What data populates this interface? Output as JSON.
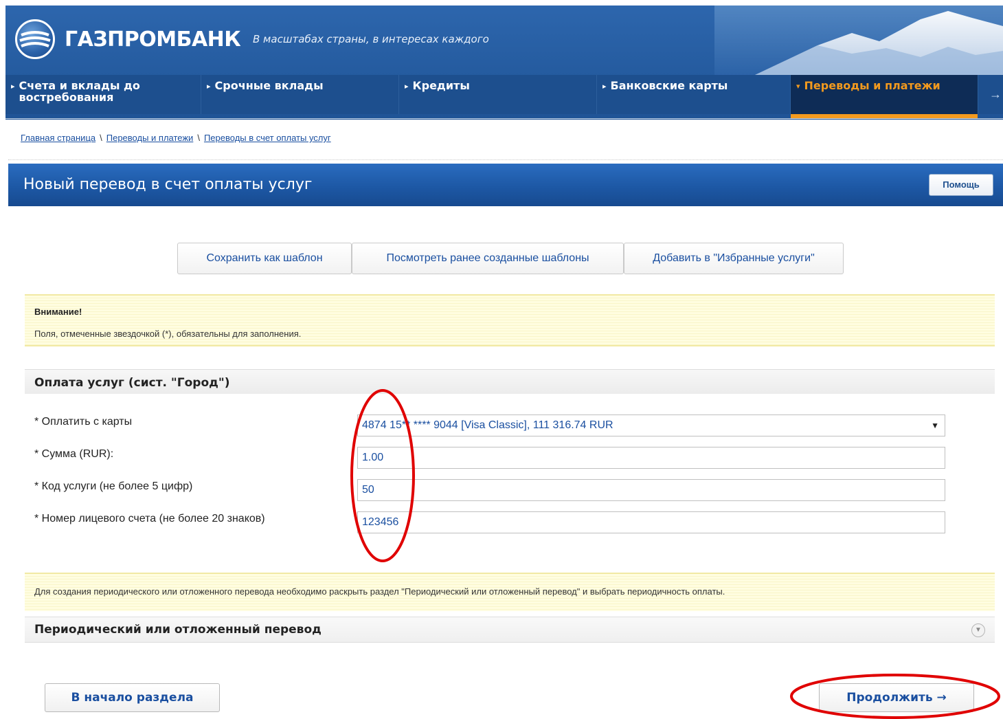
{
  "brand": {
    "name": "ГАЗПРОМБАНК",
    "slogan": "В масштабах страны, в интересах каждого"
  },
  "colors": {
    "header_blue": "#1f5496",
    "nav_active_bg": "#0e2c56",
    "nav_active_accent": "#f39a1e",
    "link_blue": "#1a4fa0",
    "annotation_red": "#e00000",
    "notice_yellow": "#fffde0"
  },
  "nav": {
    "items": [
      {
        "label": "Счета и вклады до востребования",
        "icon": "triangle-right-icon",
        "active": false
      },
      {
        "label": "Срочные вклады",
        "icon": "triangle-right-icon",
        "active": false
      },
      {
        "label": "Кредиты",
        "icon": "triangle-right-icon",
        "active": false
      },
      {
        "label": "Банковские карты",
        "icon": "triangle-right-icon",
        "active": false
      },
      {
        "label": "Переводы и платежи",
        "icon": "triangle-down-icon",
        "active": true
      }
    ],
    "more_icon": "arrow-right-icon"
  },
  "breadcrumb": {
    "items": [
      "Главная страница",
      "Переводы и платежи",
      "Переводы в счет оплаты услуг"
    ],
    "separator": "\\"
  },
  "page": {
    "title": "Новый перевод в счет оплаты услуг",
    "help_label": "Помощь"
  },
  "actions": {
    "save_template": "Сохранить как шаблон",
    "view_templates": "Посмотреть ранее созданные шаблоны",
    "add_favorites": "Добавить в \"Избранные услуги\""
  },
  "notice": {
    "title": "Внимание!",
    "text": "Поля, отмеченные звездочкой (*), обязательны для заполнения."
  },
  "form": {
    "section_title": "Оплата услуг (сист. \"Город\")",
    "fields": [
      {
        "label": "* Оплатить с карты",
        "value": "4874 15** **** 9044 [Visa Classic], 111 316.74 RUR",
        "type": "select"
      },
      {
        "label": "* Сумма (RUR):",
        "value": "1.00",
        "type": "text"
      },
      {
        "label": "* Код услуги (не более 5 цифр)",
        "value": "50",
        "type": "text"
      },
      {
        "label": "* Номер лицевого счета (не более 20 знаков)",
        "value": "123456",
        "type": "text"
      }
    ]
  },
  "periodic": {
    "notice": "Для создания периодического или отложенного перевода необходимо раскрыть раздел \"Периодический или отложенный перевод\" и выбрать периодичность оплаты.",
    "title": "Периодический или отложенный перевод",
    "expand_icon": "chevron-down-icon"
  },
  "bottom": {
    "back_label": "В начало раздела",
    "continue_label": "Продолжить →"
  }
}
